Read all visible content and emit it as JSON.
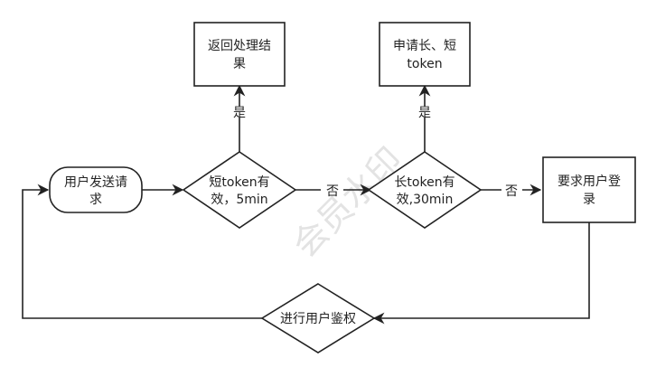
{
  "diagram": {
    "nodes": {
      "start": {
        "lines": [
          "用户发送请",
          "求"
        ]
      },
      "short_check": {
        "lines": [
          "短token有",
          "效，5min"
        ]
      },
      "long_check": {
        "lines": [
          "长token有",
          "效,30min"
        ]
      },
      "return_result": {
        "lines": [
          "返回处理结",
          "果"
        ]
      },
      "request_tokens": {
        "lines": [
          "申请长、短",
          "token"
        ]
      },
      "require_login": {
        "lines": [
          "要求用户登",
          "录"
        ]
      },
      "auth": {
        "lines": [
          "进行用户鉴权"
        ]
      }
    },
    "edges": {
      "yes_1": "是",
      "yes_2": "是",
      "no_1": "否",
      "no_2": "否"
    },
    "watermark": "会员水印"
  },
  "colors": {
    "stroke": "#222222",
    "text": "#222222",
    "watermark": "#d8d8d8"
  }
}
